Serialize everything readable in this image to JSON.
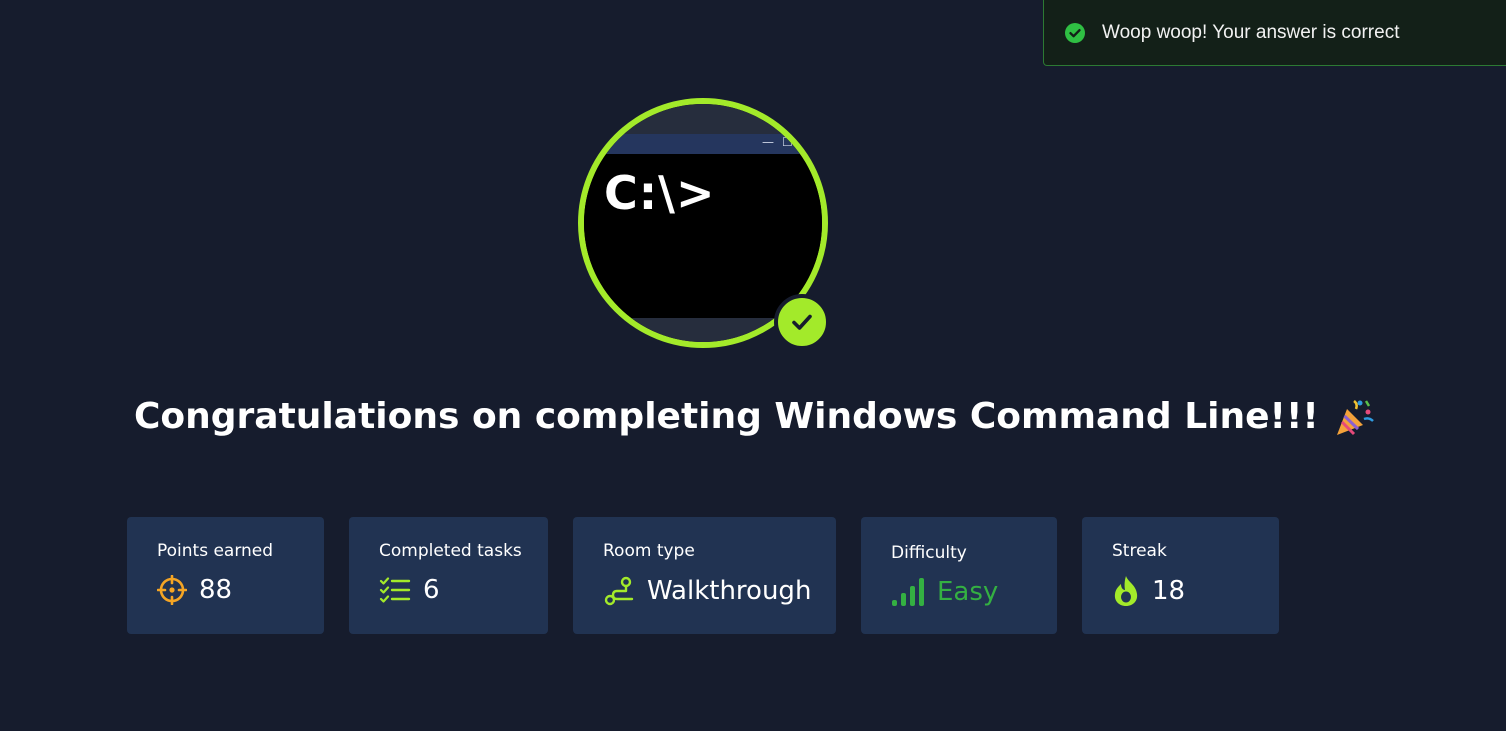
{
  "toast": {
    "message": "Woop woop! Your answer is correct",
    "icon": "check-circle-icon"
  },
  "badge": {
    "prompt": "C:\\>",
    "check_icon": "check-icon"
  },
  "heading": {
    "text": "Congratulations on completing Windows Command Line!!!",
    "emoji_icon": "party-popper-icon"
  },
  "stats": [
    {
      "label": "Points earned",
      "value": "88",
      "icon": "crosshair-icon"
    },
    {
      "label": "Completed tasks",
      "value": "6",
      "icon": "checklist-icon"
    },
    {
      "label": "Room type",
      "value": "Walkthrough",
      "icon": "route-icon"
    },
    {
      "label": "Difficulty",
      "value": "Easy",
      "icon": "signal-bars-icon"
    },
    {
      "label": "Streak",
      "value": "18",
      "icon": "flame-icon"
    }
  ],
  "colors": {
    "background": "#161c2d",
    "card": "#213352",
    "accent_green": "#a3ea2a",
    "easy_green": "#34b042",
    "points_orange": "#f5a524",
    "toast_border": "#2c7a33"
  }
}
